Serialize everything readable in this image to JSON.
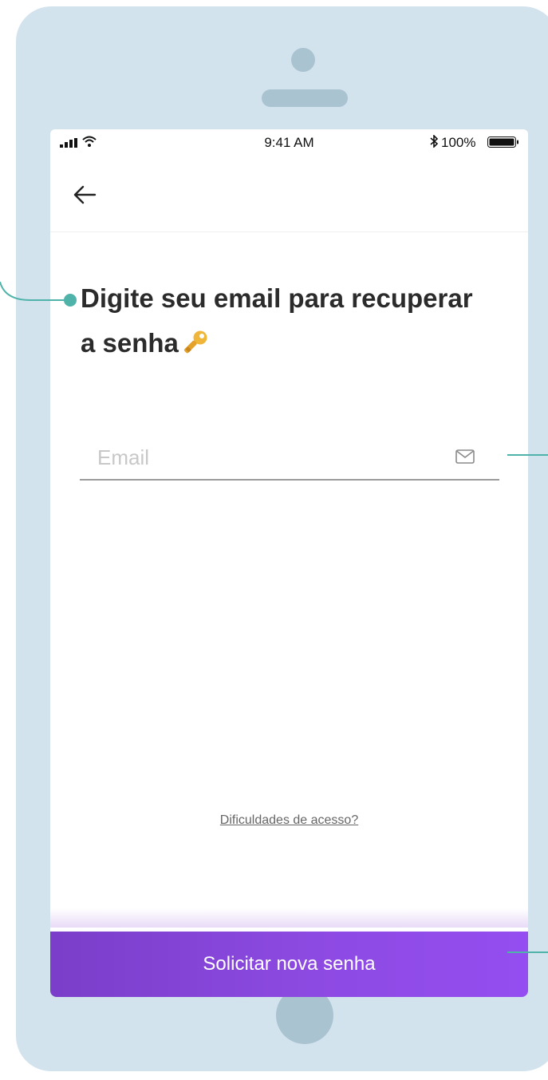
{
  "status_bar": {
    "time": "9:41 AM",
    "battery": "100%"
  },
  "nav": {
    "back_icon": "arrow-left-icon"
  },
  "content": {
    "title": "Digite seu email para recuperar a senha",
    "title_emoji": "key-icon"
  },
  "email_field": {
    "placeholder": "Email",
    "value": "",
    "icon": "mail-icon"
  },
  "help_link": "Dificuldades de acesso?",
  "submit_button": "Solicitar nova senha",
  "colors": {
    "device_frame": "#d3e3ee",
    "device_details": "#a9c3d1",
    "accent": "#8d4ae2",
    "annotation": "#4fb3a9"
  }
}
